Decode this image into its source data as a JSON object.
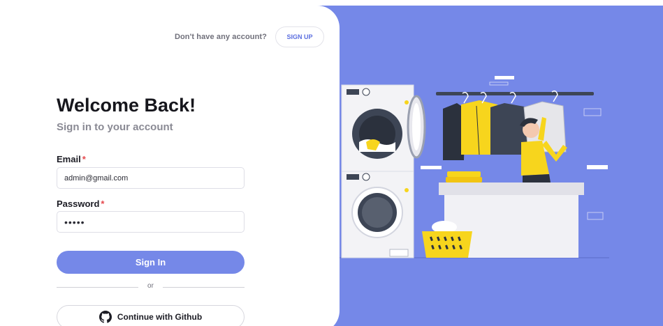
{
  "header": {
    "signup_prompt": "Don't have any account?",
    "signup_label": "SIGN UP"
  },
  "form": {
    "title": "Welcome Back!",
    "subtitle": "Sign in to your account",
    "email_label": "Email",
    "email_value": "admin@gmail.com",
    "password_label": "Password",
    "password_value": "•••••",
    "required_mark": "*",
    "signin_label": "Sign In",
    "divider_text": "or",
    "github_label": "Continue with Github"
  },
  "colors": {
    "accent": "#7588e8",
    "required": "#e5484d",
    "illustration_yellow": "#f7d51d"
  },
  "icons": {
    "github": "github-icon"
  }
}
